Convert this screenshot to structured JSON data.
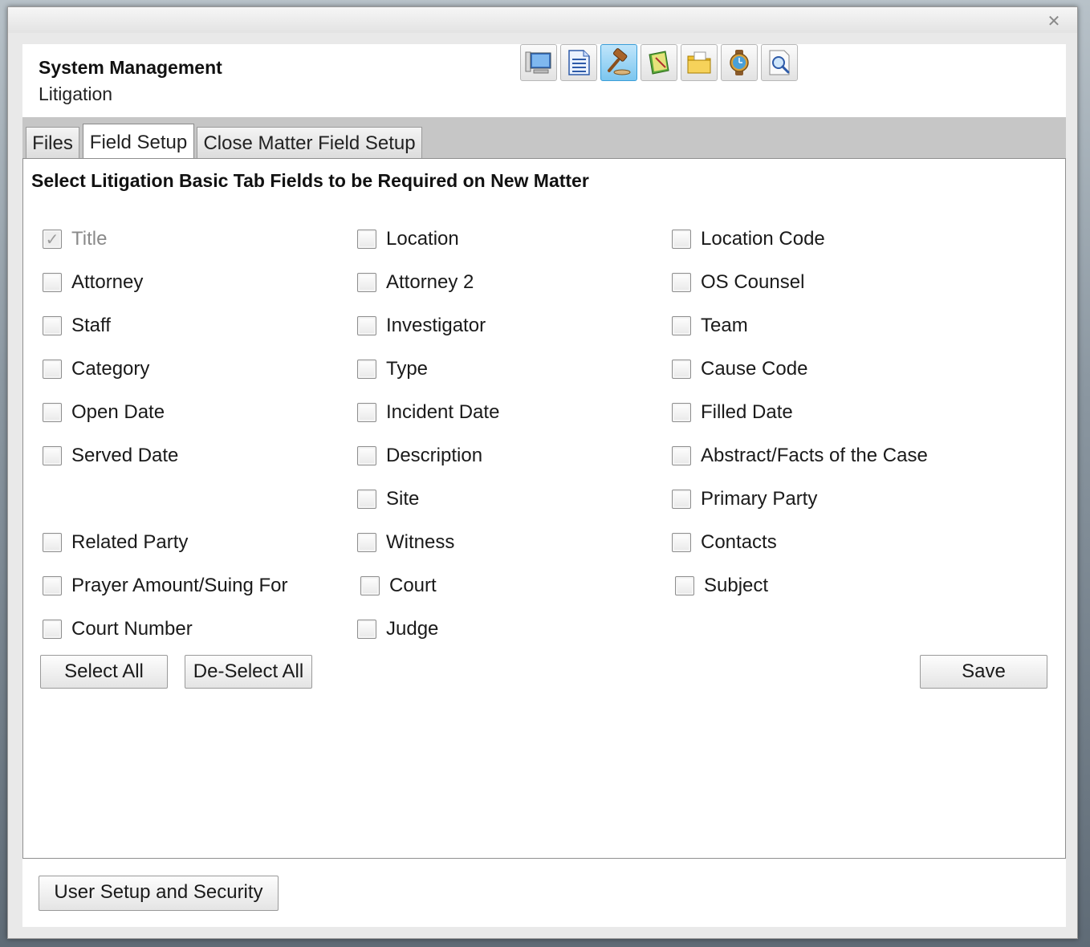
{
  "window": {
    "close_glyph": "✕"
  },
  "header": {
    "title": "System Management",
    "subtitle": "Litigation"
  },
  "toolbar": {
    "icons": [
      {
        "name": "computer-icon"
      },
      {
        "name": "document-icon"
      },
      {
        "name": "gavel-icon",
        "active": true
      },
      {
        "name": "notebook-icon"
      },
      {
        "name": "folder-icon"
      },
      {
        "name": "watch-icon"
      },
      {
        "name": "magnifier-document-icon"
      }
    ]
  },
  "tabs": [
    {
      "label": "Files"
    },
    {
      "label": "Field Setup",
      "active": true
    },
    {
      "label": "Close Matter Field Setup"
    }
  ],
  "panel": {
    "heading": "Select Litigation Basic Tab Fields to be Required on New Matter",
    "checkboxes": {
      "title": {
        "label": "Title",
        "checked": true,
        "disabled": true
      },
      "location": {
        "label": "Location",
        "checked": false
      },
      "location_code": {
        "label": "Location Code",
        "checked": false
      },
      "attorney": {
        "label": "Attorney",
        "checked": false
      },
      "attorney2": {
        "label": "Attorney 2",
        "checked": false
      },
      "os_counsel": {
        "label": "OS Counsel",
        "checked": false
      },
      "staff": {
        "label": "Staff",
        "checked": false
      },
      "investigator": {
        "label": "Investigator",
        "checked": false
      },
      "team": {
        "label": "Team",
        "checked": false
      },
      "category": {
        "label": "Category",
        "checked": false
      },
      "type": {
        "label": "Type",
        "checked": false
      },
      "cause_code": {
        "label": "Cause Code",
        "checked": false
      },
      "open_date": {
        "label": "Open Date",
        "checked": false
      },
      "incident_date": {
        "label": "Incident Date",
        "checked": false
      },
      "filled_date": {
        "label": "Filled Date",
        "checked": false
      },
      "served_date": {
        "label": "Served Date",
        "checked": false
      },
      "description": {
        "label": "Description",
        "checked": false
      },
      "abstract": {
        "label": "Abstract/Facts of the Case",
        "checked": false
      },
      "site": {
        "label": "Site",
        "checked": false
      },
      "primary_party": {
        "label": "Primary Party",
        "checked": false
      },
      "related_party": {
        "label": "Related Party",
        "checked": false
      },
      "witness": {
        "label": "Witness",
        "checked": false
      },
      "contacts": {
        "label": "Contacts",
        "checked": false
      },
      "prayer_amount": {
        "label": "Prayer Amount/Suing For",
        "checked": false
      },
      "court": {
        "label": "Court",
        "checked": false
      },
      "subject": {
        "label": "Subject",
        "checked": false
      },
      "court_number": {
        "label": "Court Number",
        "checked": false
      },
      "judge": {
        "label": "Judge",
        "checked": false
      }
    },
    "buttons": {
      "select_all": "Select All",
      "deselect_all": "De-Select All",
      "save": "Save"
    }
  },
  "footer": {
    "user_setup_label": "User Setup and Security"
  }
}
